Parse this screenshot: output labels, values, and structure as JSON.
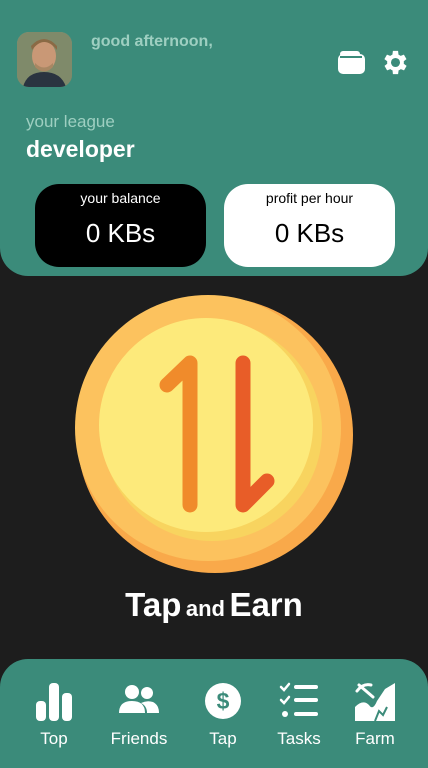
{
  "header": {
    "greeting": "good afternoon,",
    "league_label": "your league",
    "league_value": "developer",
    "avatar_icon": "user-avatar",
    "wallet_icon": "wallet-icon",
    "settings_icon": "gear-icon"
  },
  "balance_card": {
    "label": "your balance",
    "value": "0 KBs"
  },
  "profit_card": {
    "label": "profit per hour",
    "value": "0 KBs"
  },
  "tap": {
    "title_part1": "Tap",
    "title_part2": "and",
    "title_part3": "Earn",
    "coin_icon": "up-down-arrows-coin"
  },
  "nav": {
    "items": [
      {
        "label": "Top",
        "icon": "bar-chart-icon"
      },
      {
        "label": "Friends",
        "icon": "users-icon"
      },
      {
        "label": "Tap",
        "icon": "dollar-coin-icon"
      },
      {
        "label": "Tasks",
        "icon": "checklist-icon"
      },
      {
        "label": "Farm",
        "icon": "farm-icon"
      }
    ]
  },
  "colors": {
    "primary": "#3b8b7a",
    "background": "#1d1d1d",
    "coin_outer": "#fbb347",
    "coin_inner": "#fde57a",
    "arrow": "#ea6a27"
  }
}
